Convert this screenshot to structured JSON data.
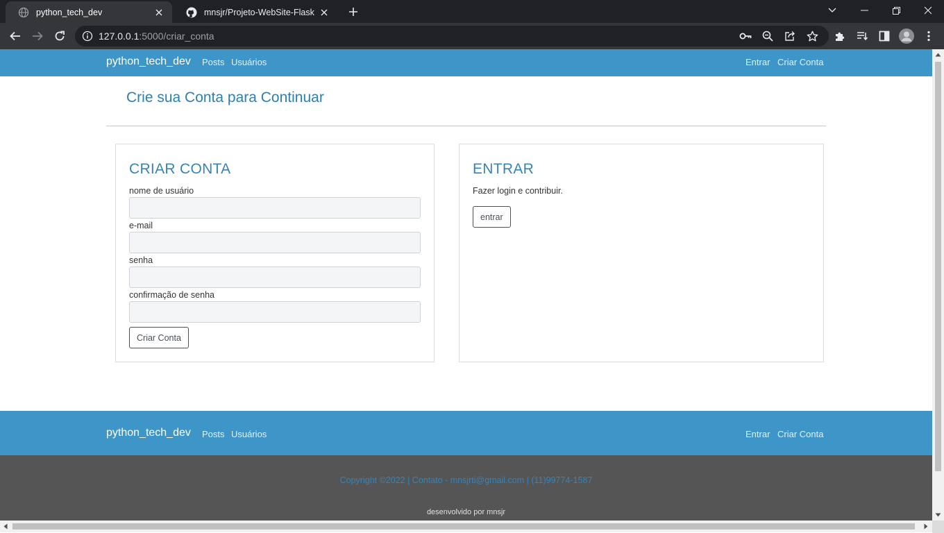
{
  "browser": {
    "tabs": [
      {
        "title": "python_tech_dev",
        "favicon": "globe-icon",
        "active": true
      },
      {
        "title": "mnsjr/Projeto-WebSite-Flask",
        "favicon": "github-icon",
        "active": false
      }
    ],
    "url_host": "127.0.0.1",
    "url_rest": ":5000/criar_conta"
  },
  "navbar": {
    "brand": "python_tech_dev",
    "links": {
      "posts": "Posts",
      "users": "Usuários",
      "login": "Entrar",
      "signup": "Criar Conta"
    }
  },
  "page_title": "Crie sua Conta para Continuar",
  "signup_card": {
    "title": "CRIAR CONTA",
    "fields": {
      "username": {
        "label": "nome de usuário",
        "value": ""
      },
      "email": {
        "label": "e-mail",
        "value": ""
      },
      "password": {
        "label": "senha",
        "value": ""
      },
      "confirm": {
        "label": "confirmação de senha",
        "value": ""
      }
    },
    "submit_label": "Criar Conta"
  },
  "login_card": {
    "title": "ENTRAR",
    "text": "Fazer login e contribuir.",
    "button_label": "entrar"
  },
  "footer": {
    "brand": "python_tech_dev",
    "links": {
      "posts": "Posts",
      "users": "Usuários",
      "login": "Entrar",
      "signup": "Criar Conta"
    },
    "copyright": "Copyright ©2022 | Contato - mnsjrti@gmail.com | (11)99774-1587",
    "developed_by": "desenvolvido por mnsjr"
  },
  "colors": {
    "navbar": "#3e95c8",
    "heading": "#2d7fb2",
    "footer_dark": "#555555"
  }
}
